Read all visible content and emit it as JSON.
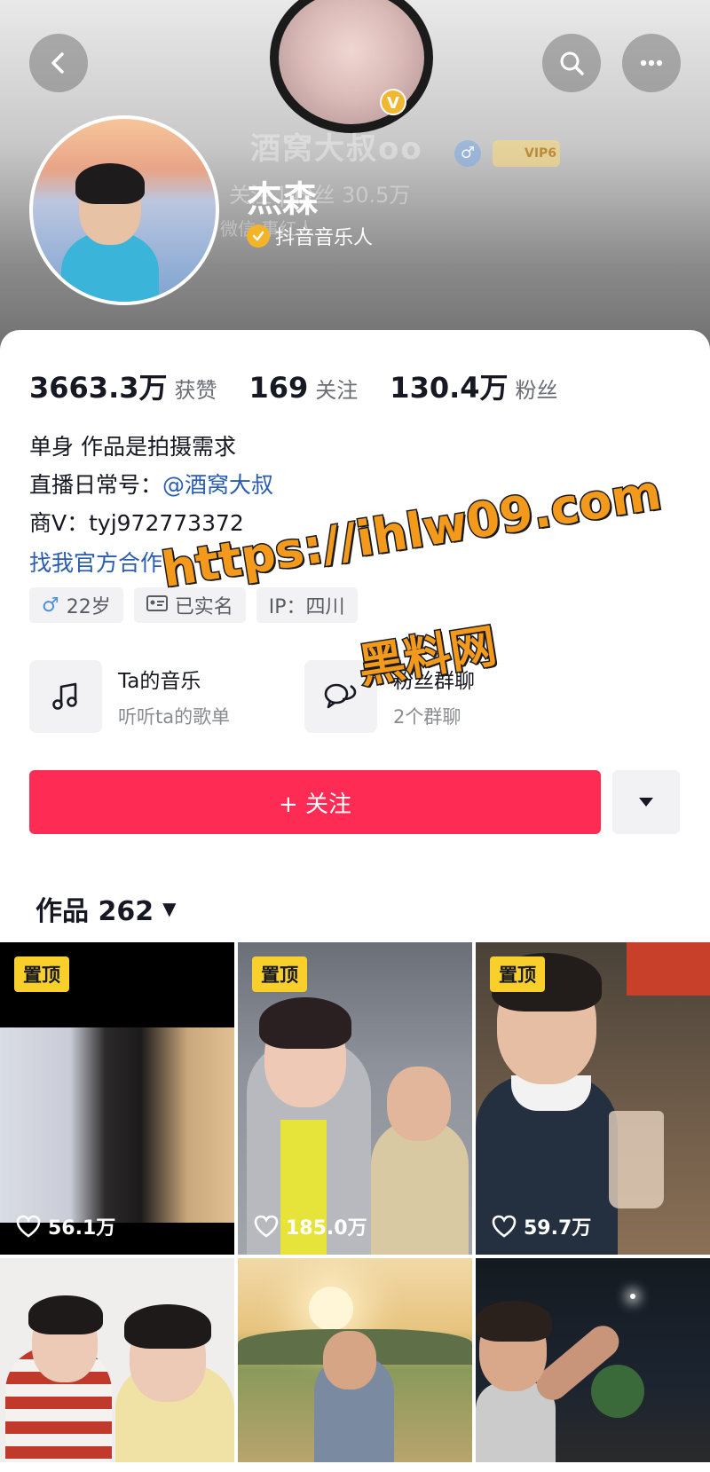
{
  "header": {
    "nav_buttons": {
      "back_icon": "chevron-left-icon",
      "search_icon": "search-icon",
      "more_icon": "more-dots-icon"
    },
    "background_profile": {
      "name": "酒窝大叔oo",
      "subtext": "关注 | 粉丝 30.5万",
      "subtext2": "微信 事红人",
      "vip_label": "VIP6"
    },
    "profile": {
      "name": "杰森",
      "verification": "抖音音乐人"
    }
  },
  "stats": [
    {
      "value": "3663.3万",
      "label": "获赞"
    },
    {
      "value": "169",
      "label": "关注"
    },
    {
      "value": "130.4万",
      "label": "粉丝"
    }
  ],
  "bio": {
    "line1": "单身 作品是拍摄需求",
    "line2_prefix": "直播日常号：",
    "line2_mention": "@酒窝大叔",
    "line3": "商V：tyj972773372",
    "link": "找我官方合作"
  },
  "tags": [
    {
      "icon": "male-icon",
      "text": "22岁"
    },
    {
      "icon": "id-card-icon",
      "text": "已实名"
    },
    {
      "icon": "",
      "text": "IP：四川"
    }
  ],
  "features": [
    {
      "icon": "music-note-icon",
      "title": "Ta的音乐",
      "subtitle": "听听ta的歌单"
    },
    {
      "icon": "chat-bubbles-icon",
      "title": "粉丝群聊",
      "subtitle": "2个群聊"
    }
  ],
  "follow_button": "+ 关注",
  "works_header": "作品 262",
  "videos": [
    {
      "pinned": "置顶",
      "likes": "56.1万"
    },
    {
      "pinned": "置顶",
      "likes": "185.0万"
    },
    {
      "pinned": "置顶",
      "likes": "59.7万"
    },
    {
      "pinned": "",
      "likes": ""
    },
    {
      "pinned": "",
      "likes": ""
    },
    {
      "pinned": "",
      "likes": ""
    }
  ],
  "watermark": {
    "url": "https://ihlw09.com",
    "text": "黑料网"
  },
  "colors": {
    "accent": "#fe2c55",
    "link": "#2a5db0",
    "pin": "#f9d02b",
    "verify": "#f4b42a",
    "watermark": "#f39a1c"
  }
}
